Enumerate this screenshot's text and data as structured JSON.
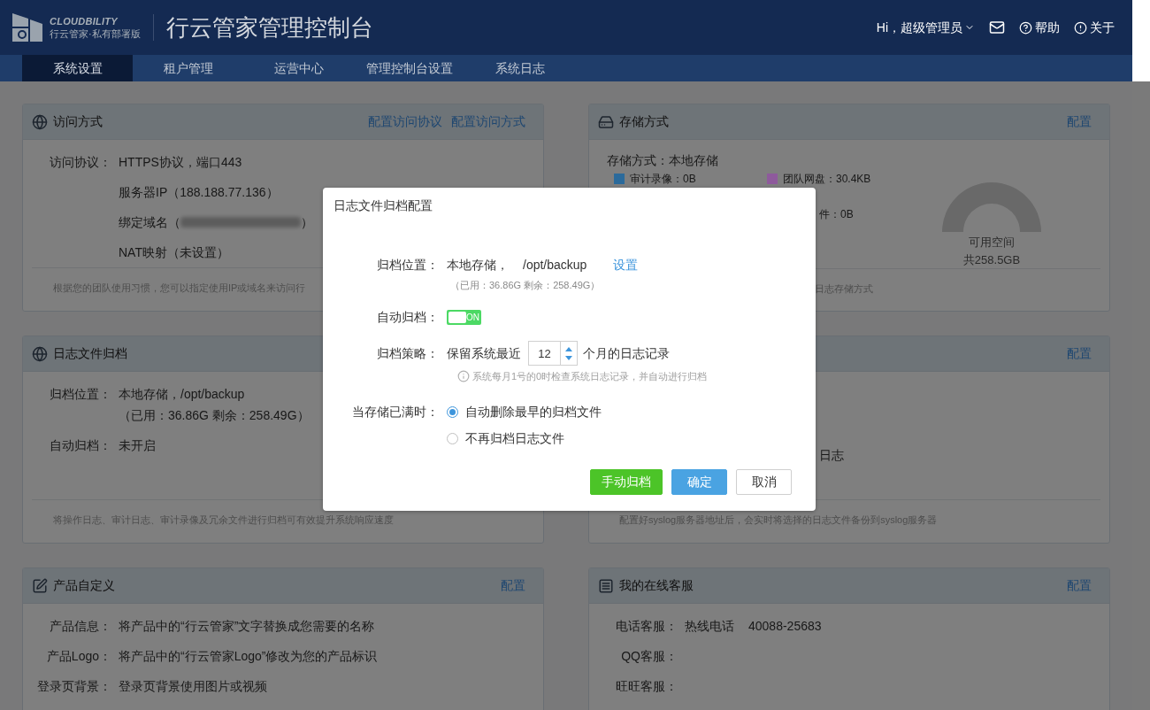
{
  "header": {
    "logo_text": "CLOUDBILITY",
    "logo_subtitle": "行云管家·私有部署版",
    "title": "行云管家管理控制台",
    "user": "Hi，超级管理员",
    "links": [
      {
        "kind": "mail"
      },
      {
        "kind": "help",
        "label": "帮助"
      },
      {
        "kind": "about",
        "label": "关于"
      }
    ]
  },
  "nav": [
    {
      "label": "系统设置",
      "selected": true
    },
    {
      "label": "租户管理",
      "selected": false
    },
    {
      "label": "运营中心",
      "selected": false
    },
    {
      "label": "管理控制台设置",
      "selected": false
    },
    {
      "label": "系统日志",
      "selected": false
    }
  ],
  "cards": [
    {
      "kind": "access",
      "title": "访问方式",
      "actions": [
        "配置访问协议",
        "配置访问方式"
      ],
      "rows": [
        {
          "label": "访问协议：",
          "values": [
            "HTTPS协议，端口443"
          ]
        },
        {
          "values": [
            "服务器IP（188.188.77.136）"
          ]
        },
        {
          "values": [
            "绑定域名（"
          ],
          "redacted": true,
          "after": "）"
        },
        {
          "values": [
            "NAT映射（未设置）"
          ]
        }
      ],
      "footnote": "根据您的团队使用习惯，您可以指定使用IP或域名来访问行"
    },
    {
      "kind": "storage",
      "title": "存储方式",
      "actions": [
        "配置"
      ],
      "summary": "存储方式：本地存储",
      "legend": [
        [
          {
            "color": "#2b6a9b",
            "text": "审计录像：0B"
          },
          {
            "color": "#8e5a9c",
            "text": "团队网盘：30.4KB"
          }
        ],
        [
          {
            "text": "件：0B"
          }
        ]
      ],
      "gauge": {
        "label": "可用空间",
        "total": "共258.5GB"
      },
      "footnote": "日志存储方式"
    },
    {
      "kind": "archive",
      "title": "日志文件归档",
      "rows": [
        {
          "label": "归档位置：",
          "values": [
            "本地存储，/opt/backup"
          ],
          "sub": "（已用：36.86G 剩余：258.49G）"
        },
        {
          "label": "自动归档：",
          "values": [
            "未开启"
          ]
        }
      ],
      "footnote": "将操作日志、审计日志、审计录像及冗余文件进行归档可有效提升系统响应速度"
    },
    {
      "kind": "syslog",
      "actions": [
        "配置"
      ],
      "text": "日志",
      "footnote": "配置好syslog服务器地址后，会实时将选择的日志文件备份到syslog服务器"
    },
    {
      "kind": "product",
      "title": "产品自定义",
      "actions": [
        "配置"
      ],
      "rows": [
        {
          "label": "产品信息：",
          "values": [
            "将产品中的“行云管家”文字替换成您需要的名称"
          ]
        },
        {
          "label": "产品Logo：",
          "values": [
            "将产品中的“行云管家Logo”修改为您的产品标识"
          ]
        },
        {
          "label": "登录页背景：",
          "values": [
            "登录页背景使用图片或视频"
          ]
        }
      ]
    },
    {
      "kind": "support",
      "title": "我的在线客服",
      "actions": [
        "配置"
      ],
      "rows": [
        {
          "label": "电话客服：",
          "values": [
            "热线电话",
            "40088-25683"
          ]
        },
        {
          "label": "QQ客服："
        },
        {
          "label": "旺旺客服："
        }
      ]
    }
  ],
  "dialog": {
    "title": "日志文件归档配置",
    "location": {
      "label": "归档位置：",
      "storage": "本地存储，",
      "path": "/opt/backup",
      "link": "设置",
      "usage": "（已用：36.86G 剩余：258.49G）"
    },
    "auto": {
      "label": "自动归档：",
      "on": true,
      "text": "ON"
    },
    "policy": {
      "label": "归档策略：",
      "before": "保留系统最近",
      "value": "12",
      "after": "个月的日志记录",
      "hint": "系统每月1号的0时检查系统日志记录，并自动进行归档"
    },
    "when_full": {
      "label": "当存储已满时：",
      "options": [
        {
          "label": "自动删除最早的归档文件",
          "selected": true
        },
        {
          "label": "不再归档日志文件",
          "selected": false
        }
      ]
    },
    "buttons": [
      {
        "kind": "manual",
        "label": "手动归档"
      },
      {
        "kind": "primary",
        "label": "确定"
      },
      {
        "kind": "cancel",
        "label": "取消"
      }
    ]
  }
}
